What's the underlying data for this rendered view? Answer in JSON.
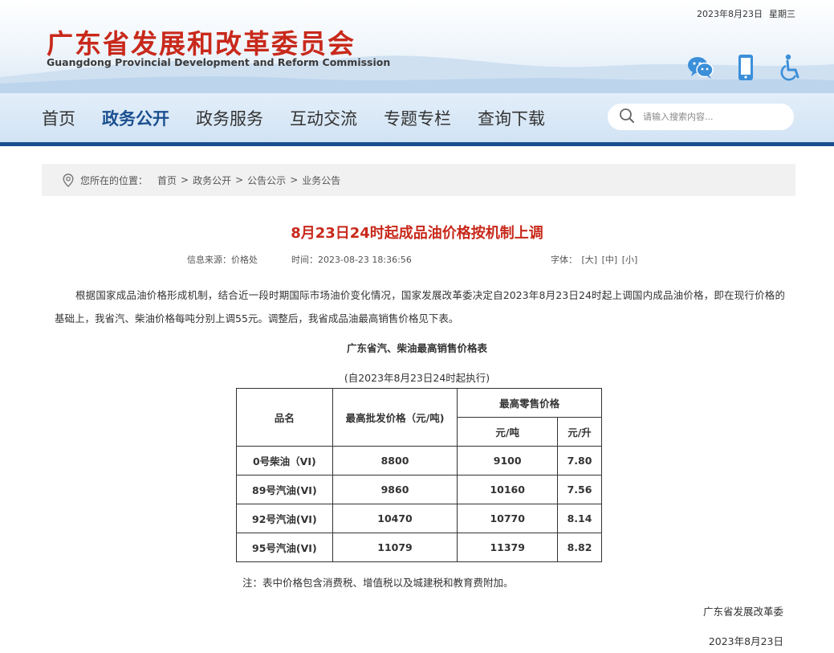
{
  "header": {
    "date": "2023年8月23日",
    "weekday": "星期三",
    "logo_cn": "广东省发展和改革委员会",
    "logo_en": "Guangdong Provincial Development and Reform Commission",
    "icons": [
      "wechat-icon",
      "mobile-icon",
      "accessibility-icon"
    ]
  },
  "nav": {
    "items": [
      "首页",
      "政务公开",
      "政务服务",
      "互动交流",
      "专题专栏",
      "查询下载"
    ],
    "active": "政务公开",
    "search_placeholder": "请输入搜索内容..."
  },
  "breadcrumb": {
    "prefix": "您所在的位置：",
    "items": [
      "首页",
      "政务公开",
      "公告公示",
      "业务公告"
    ],
    "separator": ">"
  },
  "article": {
    "title": "8月23日24时起成品油价格按机制上调",
    "source": "信息来源：价格处",
    "time": "时间：2023-08-23 18:36:56",
    "font_label": "字体：",
    "font_sizes": [
      "[大]",
      "[中]",
      "[小]"
    ],
    "paragraph": "根据国家成品油价格形成机制，结合近一段时期国际市场油价变化情况，国家发展改革委决定自2023年8月23日24时起上调国内成品油价格，即在现行价格的基础上，我省汽、柴油价格每吨分别上调55元。调整后，我省成品油最高销售价格见下表。",
    "table_title": "广东省汽、柴油最高销售价格表",
    "table_subtitle": "(自2023年8月23日24时起执行)",
    "note": "注：表中价格包含消费税、增值税以及城建税和教育费附加。",
    "signature_org": "广东省发展改革委",
    "signature_date": "2023年8月23日"
  },
  "price_table": {
    "headers": {
      "name": "品名",
      "wholesale": "最高批发价格（元/吨)",
      "retail": "最高零售价格",
      "per_ton": "元/吨",
      "per_liter": "元/升"
    },
    "rows": [
      {
        "name": "0号柴油（VI)",
        "wholesale": "8800",
        "per_ton": "9100",
        "per_liter": "7.80"
      },
      {
        "name": "89号汽油(VI)",
        "wholesale": "9860",
        "per_ton": "10160",
        "per_liter": "7.56"
      },
      {
        "name": "92号汽油(VI)",
        "wholesale": "10470",
        "per_ton": "10770",
        "per_liter": "8.14"
      },
      {
        "name": "95号汽油(VI)",
        "wholesale": "11079",
        "per_ton": "11379",
        "per_liter": "8.82"
      }
    ]
  },
  "colors": {
    "brand_red": "#c8291b",
    "nav_blue": "#1a4f8f",
    "icon_blue": "#3b8fd9"
  }
}
